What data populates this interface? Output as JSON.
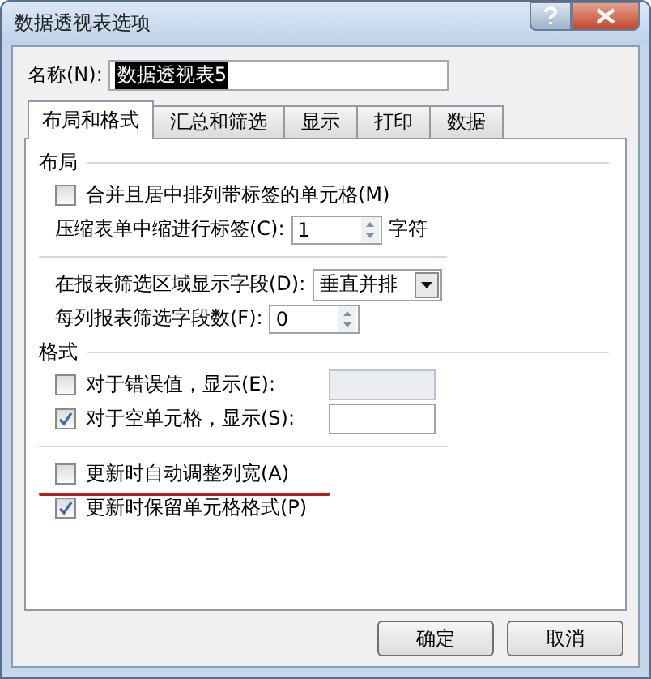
{
  "window": {
    "title": "数据透视表选项"
  },
  "name_field": {
    "label": "名称(N):",
    "value": "数据透视表5",
    "value_selected": true
  },
  "tabs": [
    {
      "label": "布局和格式",
      "selected": true
    },
    {
      "label": "汇总和筛选",
      "selected": false
    },
    {
      "label": "显示",
      "selected": false
    },
    {
      "label": "打印",
      "selected": false
    },
    {
      "label": "数据",
      "selected": false
    }
  ],
  "sections": [
    {
      "title": "布局",
      "rows": [
        {
          "kind": "checkbox",
          "label": "合并且居中排列带标签的单元格(M)",
          "checked": false
        },
        {
          "kind": "spinner",
          "label": "压缩表单中缩进行标签(C):",
          "value": "1",
          "suffix": "字符"
        },
        {
          "kind": "divider"
        },
        {
          "kind": "dropdown",
          "label": "在报表筛选区域显示字段(D):",
          "value": "垂直并排"
        },
        {
          "kind": "spinner",
          "label": "每列报表筛选字段数(F):",
          "value": "0"
        }
      ]
    },
    {
      "title": "格式",
      "rows": [
        {
          "kind": "checkfield",
          "label": "对于错误值，显示(E):",
          "checked": false
        },
        {
          "kind": "checkfield",
          "label": "对于空单元格，显示(S):",
          "checked": true
        },
        {
          "kind": "divider"
        },
        {
          "kind": "checkbox",
          "label": "更新时自动调整列宽(A)",
          "checked": false,
          "underlined": true
        },
        {
          "kind": "checkbox",
          "label": "更新时保留单元格格式(P)",
          "checked": true
        }
      ]
    }
  ],
  "buttons": [
    "确定",
    "取消"
  ]
}
